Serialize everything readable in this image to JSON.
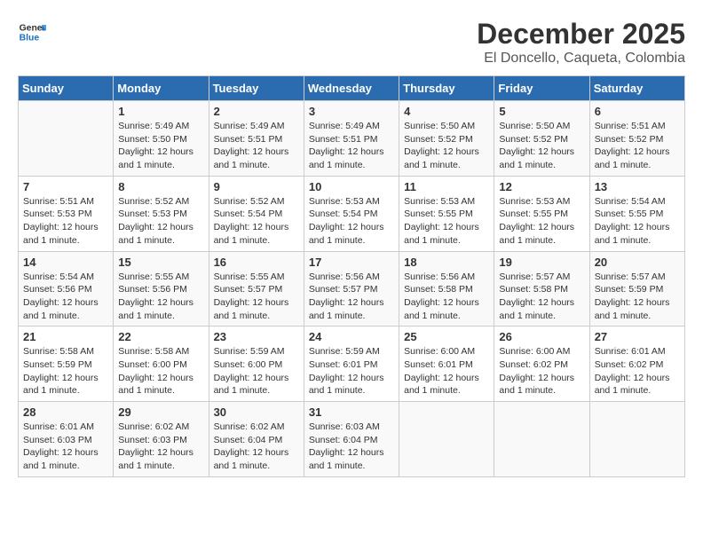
{
  "header": {
    "logo": {
      "line1": "General",
      "line2": "Blue"
    },
    "title": "December 2025",
    "subtitle": "El Doncello, Caqueta, Colombia"
  },
  "calendar": {
    "days_of_week": [
      "Sunday",
      "Monday",
      "Tuesday",
      "Wednesday",
      "Thursday",
      "Friday",
      "Saturday"
    ],
    "weeks": [
      [
        {
          "num": "",
          "info": ""
        },
        {
          "num": "1",
          "info": "Sunrise: 5:49 AM\nSunset: 5:50 PM\nDaylight: 12 hours\nand 1 minute."
        },
        {
          "num": "2",
          "info": "Sunrise: 5:49 AM\nSunset: 5:51 PM\nDaylight: 12 hours\nand 1 minute."
        },
        {
          "num": "3",
          "info": "Sunrise: 5:49 AM\nSunset: 5:51 PM\nDaylight: 12 hours\nand 1 minute."
        },
        {
          "num": "4",
          "info": "Sunrise: 5:50 AM\nSunset: 5:52 PM\nDaylight: 12 hours\nand 1 minute."
        },
        {
          "num": "5",
          "info": "Sunrise: 5:50 AM\nSunset: 5:52 PM\nDaylight: 12 hours\nand 1 minute."
        },
        {
          "num": "6",
          "info": "Sunrise: 5:51 AM\nSunset: 5:52 PM\nDaylight: 12 hours\nand 1 minute."
        }
      ],
      [
        {
          "num": "7",
          "info": "Sunrise: 5:51 AM\nSunset: 5:53 PM\nDaylight: 12 hours\nand 1 minute."
        },
        {
          "num": "8",
          "info": "Sunrise: 5:52 AM\nSunset: 5:53 PM\nDaylight: 12 hours\nand 1 minute."
        },
        {
          "num": "9",
          "info": "Sunrise: 5:52 AM\nSunset: 5:54 PM\nDaylight: 12 hours\nand 1 minute."
        },
        {
          "num": "10",
          "info": "Sunrise: 5:53 AM\nSunset: 5:54 PM\nDaylight: 12 hours\nand 1 minute."
        },
        {
          "num": "11",
          "info": "Sunrise: 5:53 AM\nSunset: 5:55 PM\nDaylight: 12 hours\nand 1 minute."
        },
        {
          "num": "12",
          "info": "Sunrise: 5:53 AM\nSunset: 5:55 PM\nDaylight: 12 hours\nand 1 minute."
        },
        {
          "num": "13",
          "info": "Sunrise: 5:54 AM\nSunset: 5:55 PM\nDaylight: 12 hours\nand 1 minute."
        }
      ],
      [
        {
          "num": "14",
          "info": "Sunrise: 5:54 AM\nSunset: 5:56 PM\nDaylight: 12 hours\nand 1 minute."
        },
        {
          "num": "15",
          "info": "Sunrise: 5:55 AM\nSunset: 5:56 PM\nDaylight: 12 hours\nand 1 minute."
        },
        {
          "num": "16",
          "info": "Sunrise: 5:55 AM\nSunset: 5:57 PM\nDaylight: 12 hours\nand 1 minute."
        },
        {
          "num": "17",
          "info": "Sunrise: 5:56 AM\nSunset: 5:57 PM\nDaylight: 12 hours\nand 1 minute."
        },
        {
          "num": "18",
          "info": "Sunrise: 5:56 AM\nSunset: 5:58 PM\nDaylight: 12 hours\nand 1 minute."
        },
        {
          "num": "19",
          "info": "Sunrise: 5:57 AM\nSunset: 5:58 PM\nDaylight: 12 hours\nand 1 minute."
        },
        {
          "num": "20",
          "info": "Sunrise: 5:57 AM\nSunset: 5:59 PM\nDaylight: 12 hours\nand 1 minute."
        }
      ],
      [
        {
          "num": "21",
          "info": "Sunrise: 5:58 AM\nSunset: 5:59 PM\nDaylight: 12 hours\nand 1 minute."
        },
        {
          "num": "22",
          "info": "Sunrise: 5:58 AM\nSunset: 6:00 PM\nDaylight: 12 hours\nand 1 minute."
        },
        {
          "num": "23",
          "info": "Sunrise: 5:59 AM\nSunset: 6:00 PM\nDaylight: 12 hours\nand 1 minute."
        },
        {
          "num": "24",
          "info": "Sunrise: 5:59 AM\nSunset: 6:01 PM\nDaylight: 12 hours\nand 1 minute."
        },
        {
          "num": "25",
          "info": "Sunrise: 6:00 AM\nSunset: 6:01 PM\nDaylight: 12 hours\nand 1 minute."
        },
        {
          "num": "26",
          "info": "Sunrise: 6:00 AM\nSunset: 6:02 PM\nDaylight: 12 hours\nand 1 minute."
        },
        {
          "num": "27",
          "info": "Sunrise: 6:01 AM\nSunset: 6:02 PM\nDaylight: 12 hours\nand 1 minute."
        }
      ],
      [
        {
          "num": "28",
          "info": "Sunrise: 6:01 AM\nSunset: 6:03 PM\nDaylight: 12 hours\nand 1 minute."
        },
        {
          "num": "29",
          "info": "Sunrise: 6:02 AM\nSunset: 6:03 PM\nDaylight: 12 hours\nand 1 minute."
        },
        {
          "num": "30",
          "info": "Sunrise: 6:02 AM\nSunset: 6:04 PM\nDaylight: 12 hours\nand 1 minute."
        },
        {
          "num": "31",
          "info": "Sunrise: 6:03 AM\nSunset: 6:04 PM\nDaylight: 12 hours\nand 1 minute."
        },
        {
          "num": "",
          "info": ""
        },
        {
          "num": "",
          "info": ""
        },
        {
          "num": "",
          "info": ""
        }
      ]
    ]
  }
}
